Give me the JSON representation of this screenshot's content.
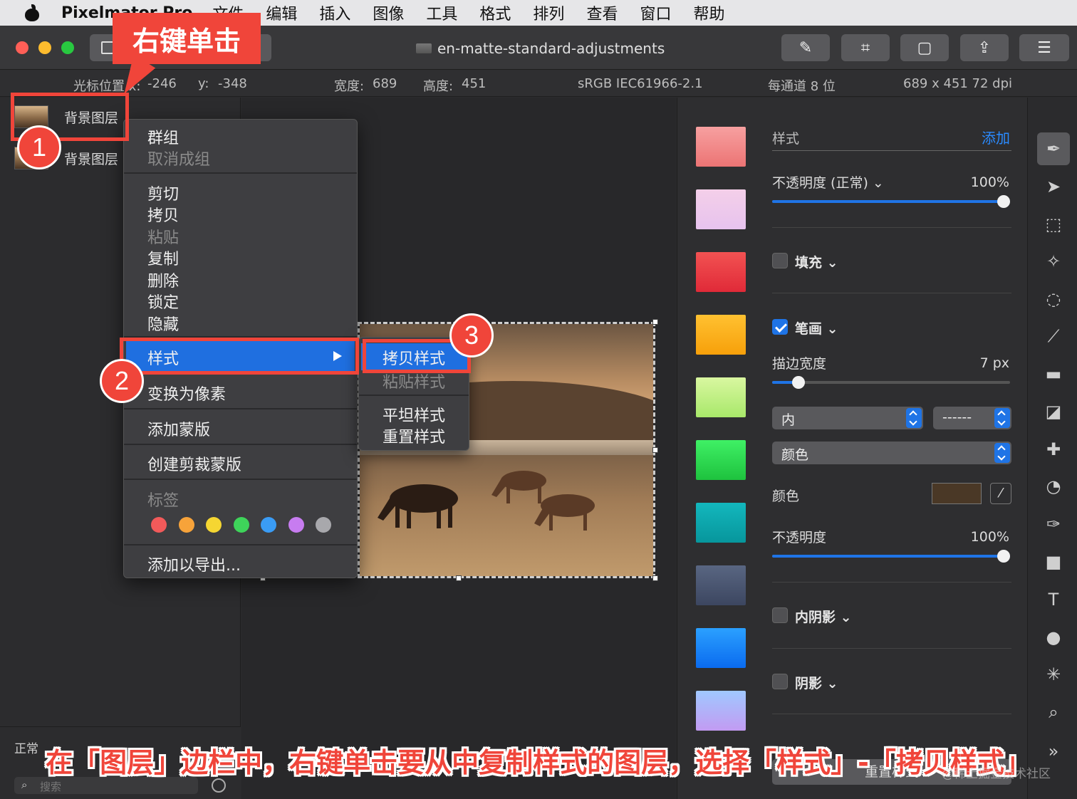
{
  "menubar": {
    "app_name": "Pixelmator Pro",
    "items": [
      "文件",
      "编辑",
      "插入",
      "图像",
      "工具",
      "格式",
      "排列",
      "查看",
      "窗口",
      "帮助"
    ]
  },
  "window": {
    "title": "en-matte-standard-adjustments"
  },
  "infobar": {
    "cursor_label": "光标位置 x:",
    "cursor_x": "-246",
    "cursor_y_label": "y:",
    "cursor_y": "-348",
    "width_label": "宽度:",
    "width_value": "689",
    "height_label": "高度:",
    "height_value": "451",
    "color_profile": "sRGB IEC61966-2.1",
    "bit_depth": "每通道 8 位",
    "size_dpi": "689 x 451 72 dpi"
  },
  "layers": [
    {
      "name": "背景图层"
    },
    {
      "name": "背景图层"
    }
  ],
  "layers_footer": {
    "blend_mode": "正常",
    "search_placeholder": "搜索"
  },
  "context_menu": {
    "items": {
      "group": "群组",
      "ungroup": "取消成组",
      "cut": "剪切",
      "copy": "拷贝",
      "paste": "粘贴",
      "duplicate": "复制",
      "delete": "删除",
      "lock": "锁定",
      "hide": "隐藏",
      "style": "样式",
      "convert_pixels": "变换为像素",
      "add_mask": "添加蒙版",
      "create_clipping_mask": "创建剪裁蒙版",
      "tags": "标签",
      "add_to_export": "添加以导出..."
    },
    "tag_colors": [
      "#f25a5a",
      "#f7a33a",
      "#f5d632",
      "#3ed45a",
      "#3a9cf5",
      "#c77cf0",
      "#a8a8ac"
    ]
  },
  "submenu": {
    "copy_style": "拷贝样式",
    "paste_style": "粘贴样式",
    "flatten_style": "平坦样式",
    "reset_style": "重置样式"
  },
  "swatches": [
    "linear-gradient(#f7a0a0,#ec7474)",
    "linear-gradient(#f4cfe9,#e7c3ee)",
    "linear-gradient(#f25252,#e02a38)",
    "linear-gradient(#ffc131,#f7a00a)",
    "linear-gradient(#d9f7a0,#a8e86a)",
    "linear-gradient(#3ff065,#1ec23e)",
    "linear-gradient(#13b7bd,#07969c)",
    "linear-gradient(#596682,#3c4660)",
    "linear-gradient(#2ba0ff,#0a6bef)",
    "linear-gradient(#a0c8ff,#c29bf2)"
  ],
  "inspector": {
    "styles_label": "样式",
    "add_label": "添加",
    "opacity_label": "不透明度 (正常) ⌄",
    "opacity_value": "100%",
    "opacity_fraction": 1.0,
    "fill_label": "填充 ⌄",
    "fill_checked": false,
    "stroke_label": "笔画 ⌄",
    "stroke_checked": true,
    "stroke_width_label": "描边宽度",
    "stroke_width_value": "7 px",
    "stroke_width_fraction": 0.09,
    "position_value": "内",
    "dash_value": "------",
    "type_value": "颜色",
    "color_label": "颜色",
    "color_swatch": "#4a3826",
    "stroke_opacity_label": "不透明度",
    "stroke_opacity_value": "100%",
    "stroke_opacity_fraction": 1.0,
    "inner_shadow_label": "内阴影 ⌄",
    "inner_shadow_checked": false,
    "shadow_label": "阴影 ⌄",
    "shadow_checked": false,
    "reset_button": "重置样式"
  },
  "tools": [
    "style-tool-icon",
    "arrow-select-icon",
    "rect-select-icon",
    "magic-wand-icon",
    "quick-select-icon",
    "brush-icon",
    "gradient-icon",
    "eraser-icon",
    "repair-icon",
    "clone-icon",
    "pen-icon",
    "shape-icon",
    "type-icon",
    "color-adjust-icon",
    "sharpen-icon",
    "zoom-icon",
    "more-tools-icon"
  ],
  "annotations": {
    "callout": "右键单击",
    "step1": "1",
    "step2": "2",
    "step3": "3",
    "caption": "在「图层」边栏中，右键单击要从中复制样式的图层，选择「样式」-「拷贝样式」",
    "watermark": "@稀土掘金技术社区"
  }
}
